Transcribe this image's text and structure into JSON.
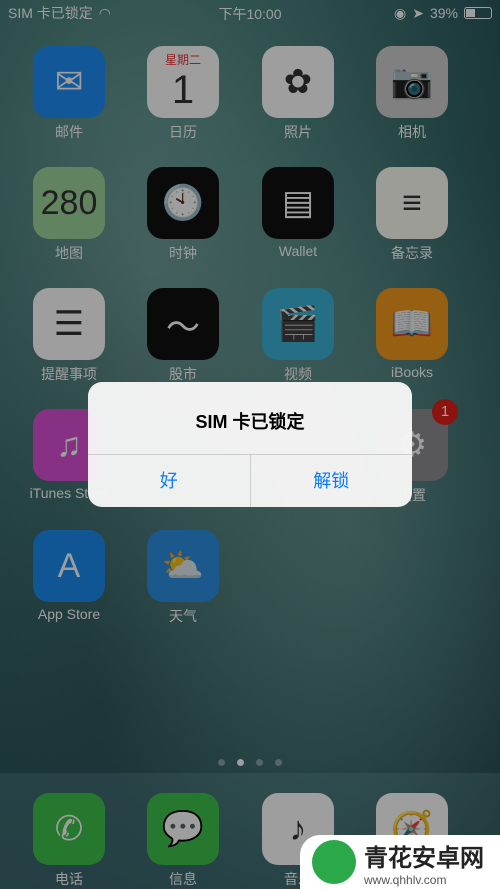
{
  "status": {
    "carrier": "SIM 卡已锁定",
    "time": "下午10:00",
    "battery": "39%",
    "battery_level": 39
  },
  "apps": [
    {
      "label": "邮件",
      "icon": "mail-icon",
      "color": "#1e8ef5",
      "glyph": "✉"
    },
    {
      "label": "日历",
      "icon": "calendar-icon",
      "color": "#ffffff",
      "glyph": "1",
      "sub": "星期二"
    },
    {
      "label": "照片",
      "icon": "photos-icon",
      "color": "#ffffff",
      "glyph": "✿"
    },
    {
      "label": "相机",
      "icon": "camera-icon",
      "color": "#cfcfcf",
      "glyph": "📷"
    },
    {
      "label": "地图",
      "icon": "maps-icon",
      "color": "#9fd39a",
      "glyph": "280"
    },
    {
      "label": "时钟",
      "icon": "clock-icon",
      "color": "#111111",
      "glyph": "🕙"
    },
    {
      "label": "Wallet",
      "icon": "wallet-icon",
      "color": "#111111",
      "glyph": "▤"
    },
    {
      "label": "备忘录",
      "icon": "notes-icon",
      "color": "#fdfdf5",
      "glyph": "≡"
    },
    {
      "label": "提醒事项",
      "icon": "reminders-icon",
      "color": "#ffffff",
      "glyph": "☰"
    },
    {
      "label": "股市",
      "icon": "stocks-icon",
      "color": "#111111",
      "glyph": "〜"
    },
    {
      "label": "视频",
      "icon": "videos-icon",
      "color": "#3ab4d8",
      "glyph": "🎬"
    },
    {
      "label": "iBooks",
      "icon": "ibooks-icon",
      "color": "#f29a1c",
      "glyph": "📖"
    },
    {
      "label": "iTunes Store",
      "icon": "itunes-store-icon",
      "color": "#d84fd6",
      "glyph": "♫"
    },
    {
      "label": "",
      "icon": "hidden-slot",
      "color": "transparent",
      "glyph": ""
    },
    {
      "label": "",
      "icon": "hidden-slot",
      "color": "transparent",
      "glyph": ""
    },
    {
      "label": "设置",
      "icon": "settings-icon",
      "color": "#8e8e93",
      "glyph": "⚙",
      "badge": "1"
    },
    {
      "label": "App Store",
      "icon": "app-store-icon",
      "color": "#1a8cf0",
      "glyph": "A"
    },
    {
      "label": "天气",
      "icon": "weather-icon",
      "color": "#2d8fe0",
      "glyph": "⛅"
    }
  ],
  "dock": [
    {
      "label": "电话",
      "icon": "phone-icon",
      "color": "#3fc24c",
      "glyph": "✆"
    },
    {
      "label": "信息",
      "icon": "messages-icon",
      "color": "#3fc24c",
      "glyph": "💬"
    },
    {
      "label": "音乐",
      "icon": "music-icon",
      "color": "#ffffff",
      "glyph": "♪"
    },
    {
      "label": "Safari",
      "icon": "safari-icon",
      "color": "#ffffff",
      "glyph": "🧭"
    }
  ],
  "page_dots": {
    "count": 4,
    "active": 1
  },
  "alert": {
    "title": "SIM 卡已锁定",
    "ok": "好",
    "unlock": "解锁"
  },
  "watermark": {
    "name": "青花安卓网",
    "url": "www.qhhlv.com"
  }
}
